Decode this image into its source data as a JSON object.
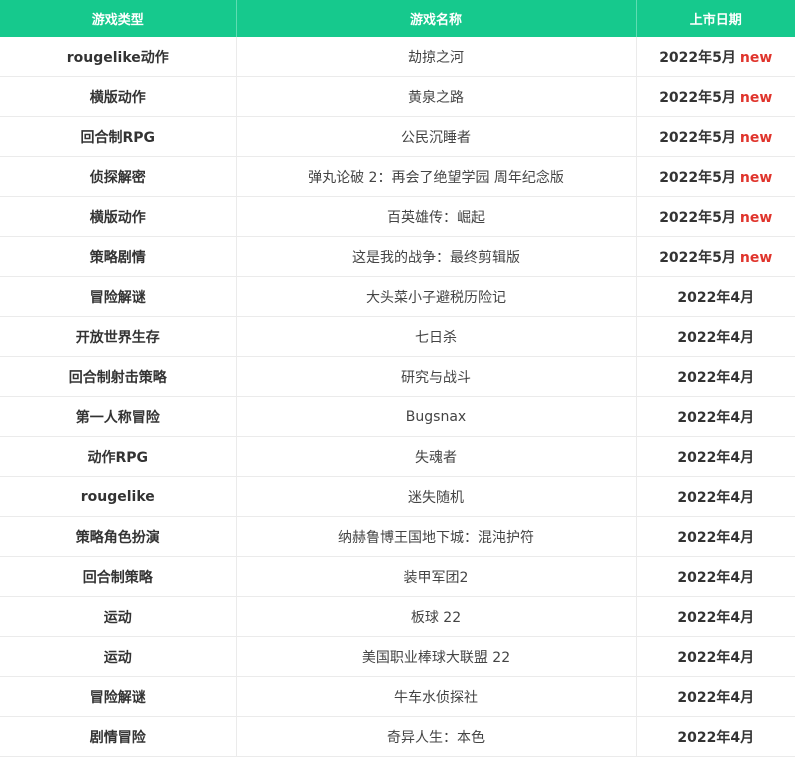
{
  "table": {
    "headers": [
      "游戏类型",
      "游戏名称",
      "上市日期"
    ],
    "new_label": "new",
    "rows": [
      {
        "type": "rougelike动作",
        "name": "劫掠之河",
        "date": "2022年5月",
        "is_new": true
      },
      {
        "type": "横版动作",
        "name": "黄泉之路",
        "date": "2022年5月",
        "is_new": true
      },
      {
        "type": "回合制RPG",
        "name": "公民沉睡者",
        "date": "2022年5月",
        "is_new": true
      },
      {
        "type": "侦探解密",
        "name": "弹丸论破 2：再会了绝望学园 周年纪念版",
        "date": "2022年5月",
        "is_new": true
      },
      {
        "type": "横版动作",
        "name": "百英雄传：崛起",
        "date": "2022年5月",
        "is_new": true
      },
      {
        "type": "策略剧情",
        "name": "这是我的战争：最终剪辑版",
        "date": "2022年5月",
        "is_new": true
      },
      {
        "type": "冒险解谜",
        "name": "大头菜小子避税历险记",
        "date": "2022年4月",
        "is_new": false
      },
      {
        "type": "开放世界生存",
        "name": "七日杀",
        "date": "2022年4月",
        "is_new": false
      },
      {
        "type": "回合制射击策略",
        "name": "研究与战斗",
        "date": "2022年4月",
        "is_new": false
      },
      {
        "type": "第一人称冒险",
        "name": "Bugsnax",
        "date": "2022年4月",
        "is_new": false
      },
      {
        "type": "动作RPG",
        "name": "失魂者",
        "date": "2022年4月",
        "is_new": false
      },
      {
        "type": "rougelike",
        "name": "迷失随机",
        "date": "2022年4月",
        "is_new": false
      },
      {
        "type": "策略角色扮演",
        "name": "纳赫鲁博王国地下城：混沌护符",
        "date": "2022年4月",
        "is_new": false
      },
      {
        "type": "回合制策略",
        "name": "装甲军团2",
        "date": "2022年4月",
        "is_new": false
      },
      {
        "type": "运动",
        "name": "板球 22",
        "date": "2022年4月",
        "is_new": false
      },
      {
        "type": "运动",
        "name": "美国职业棒球大联盟 22",
        "date": "2022年4月",
        "is_new": false
      },
      {
        "type": "冒险解谜",
        "name": "牛车水侦探社",
        "date": "2022年4月",
        "is_new": false
      },
      {
        "type": "剧情冒险",
        "name": "奇异人生：本色",
        "date": "2022年4月",
        "is_new": false
      }
    ]
  },
  "colors": {
    "header_bg": "#16c98d",
    "header_text": "#ffffff",
    "new_tag": "#e0342c"
  }
}
